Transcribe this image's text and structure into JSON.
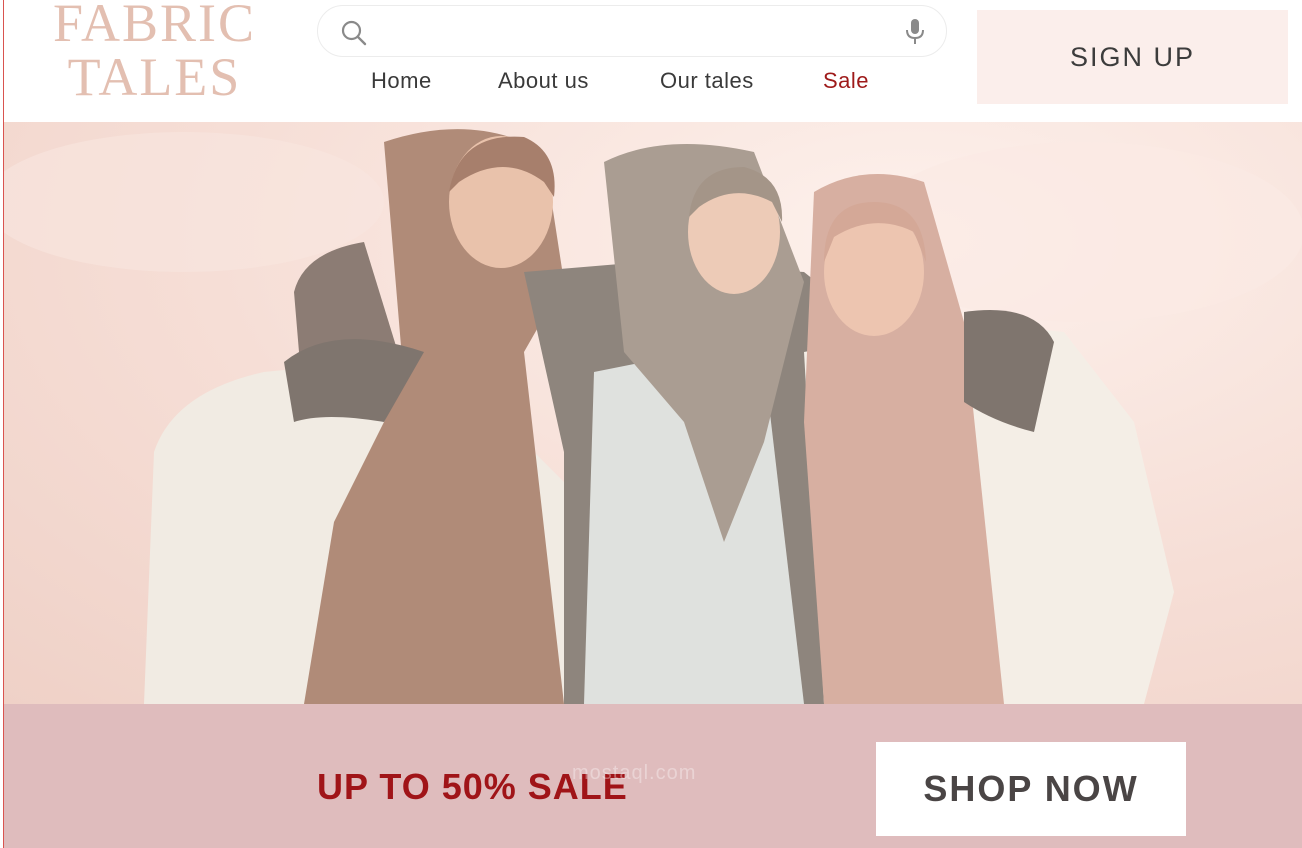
{
  "brand": {
    "logo_line1": "FABRIC",
    "logo_line2": "TALES"
  },
  "search": {
    "placeholder": "",
    "value": "",
    "icon": "search-icon",
    "voice_icon": "mic-icon"
  },
  "nav": {
    "home": "Home",
    "about": "About us",
    "tales": "Our tales",
    "sale": "Sale"
  },
  "header": {
    "signup_label": "SIGN UP"
  },
  "promo": {
    "text": "UP TO 50% SALE",
    "button_label": "SHOP NOW",
    "watermark": "mostaql.com"
  },
  "colors": {
    "logo": "#e3bfb1",
    "sale_link": "#9e1a1a",
    "signup_bg": "#fbeeeb",
    "promo_bg": "#dfbcbd",
    "promo_text": "#a01418"
  }
}
